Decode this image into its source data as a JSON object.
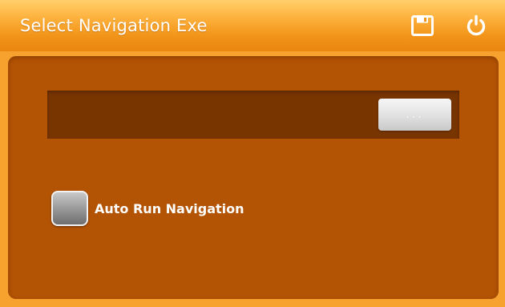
{
  "window": {
    "title": "Select Navigation Exe"
  },
  "titlebar": {
    "save_icon": "floppy-disk-save-icon",
    "power_icon": "power-icon"
  },
  "path_field": {
    "value": "",
    "browse_label": "..."
  },
  "options": {
    "auto_run_label": "Auto Run Navigation",
    "auto_run_checked": false
  },
  "colors": {
    "titlebar": "#f29419",
    "panel": "#b35304",
    "path_field": "#793500",
    "text": "#ffffff"
  }
}
